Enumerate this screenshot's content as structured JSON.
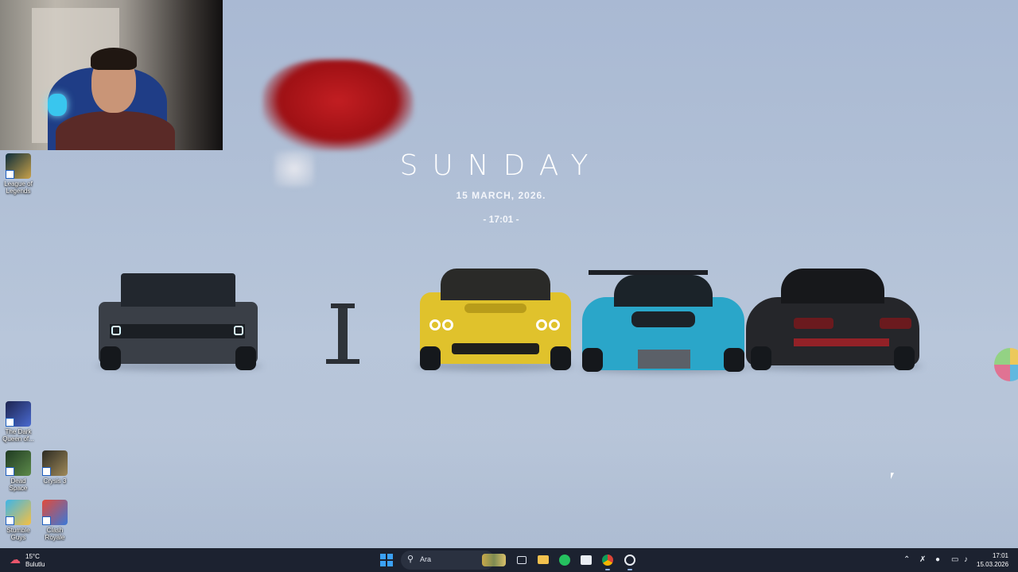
{
  "wallpaper": {
    "day": "SUNDAY",
    "date": "15  MARCH, 2026.",
    "time": "- 17:01 -"
  },
  "desktop_icons": [
    {
      "label": "League of Legends",
      "icon": "league-of-legends-icon"
    },
    {
      "label": "The Dark Queen of...",
      "icon": "dark-queen-icon"
    },
    {
      "label": "Dead Space",
      "icon": "dead-space-icon"
    },
    {
      "label": "Crysis 3",
      "icon": "crysis-3-icon"
    },
    {
      "label": "Stumble Guys",
      "icon": "stumble-guys-icon"
    },
    {
      "label": "Clash Royale",
      "icon": "clash-royale-icon"
    }
  ],
  "taskbar": {
    "weather": {
      "temp": "15°C",
      "condition": "Bulutlu",
      "icon": "weather-icon"
    },
    "search_placeholder": "Ara",
    "apps": [
      "start-icon",
      "task-view-icon",
      "file-explorer-icon",
      "whatsapp-icon",
      "store-icon",
      "chrome-icon",
      "app-icon"
    ],
    "tray": [
      "chevron-up-icon",
      "network-off-icon",
      "microphone-icon",
      "display-icon",
      "volume-icon"
    ],
    "clock_time": "17:01",
    "clock_date": "15.03.2026"
  },
  "colors": {
    "background": "#b1c0d6",
    "taskbar": "#1c2230",
    "accent": "#3ba1f5"
  }
}
